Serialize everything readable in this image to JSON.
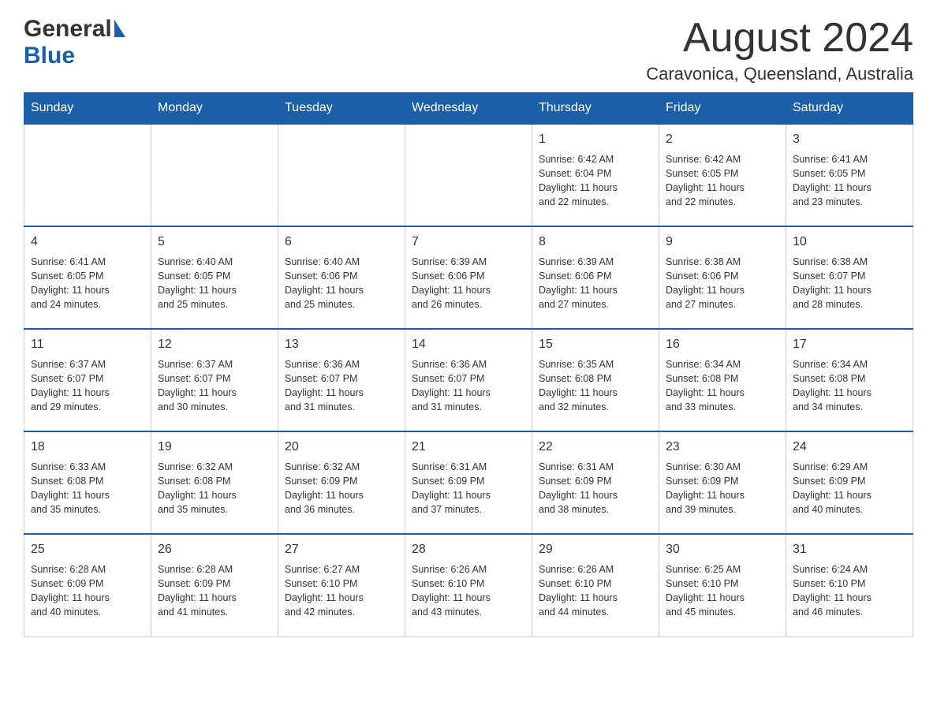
{
  "header": {
    "logo_general": "General",
    "logo_blue": "Blue",
    "month_title": "August 2024",
    "location": "Caravonica, Queensland, Australia"
  },
  "days_of_week": [
    "Sunday",
    "Monday",
    "Tuesday",
    "Wednesday",
    "Thursday",
    "Friday",
    "Saturday"
  ],
  "weeks": [
    {
      "days": [
        {
          "number": "",
          "info": ""
        },
        {
          "number": "",
          "info": ""
        },
        {
          "number": "",
          "info": ""
        },
        {
          "number": "",
          "info": ""
        },
        {
          "number": "1",
          "info": "Sunrise: 6:42 AM\nSunset: 6:04 PM\nDaylight: 11 hours\nand 22 minutes."
        },
        {
          "number": "2",
          "info": "Sunrise: 6:42 AM\nSunset: 6:05 PM\nDaylight: 11 hours\nand 22 minutes."
        },
        {
          "number": "3",
          "info": "Sunrise: 6:41 AM\nSunset: 6:05 PM\nDaylight: 11 hours\nand 23 minutes."
        }
      ]
    },
    {
      "days": [
        {
          "number": "4",
          "info": "Sunrise: 6:41 AM\nSunset: 6:05 PM\nDaylight: 11 hours\nand 24 minutes."
        },
        {
          "number": "5",
          "info": "Sunrise: 6:40 AM\nSunset: 6:05 PM\nDaylight: 11 hours\nand 25 minutes."
        },
        {
          "number": "6",
          "info": "Sunrise: 6:40 AM\nSunset: 6:06 PM\nDaylight: 11 hours\nand 25 minutes."
        },
        {
          "number": "7",
          "info": "Sunrise: 6:39 AM\nSunset: 6:06 PM\nDaylight: 11 hours\nand 26 minutes."
        },
        {
          "number": "8",
          "info": "Sunrise: 6:39 AM\nSunset: 6:06 PM\nDaylight: 11 hours\nand 27 minutes."
        },
        {
          "number": "9",
          "info": "Sunrise: 6:38 AM\nSunset: 6:06 PM\nDaylight: 11 hours\nand 27 minutes."
        },
        {
          "number": "10",
          "info": "Sunrise: 6:38 AM\nSunset: 6:07 PM\nDaylight: 11 hours\nand 28 minutes."
        }
      ]
    },
    {
      "days": [
        {
          "number": "11",
          "info": "Sunrise: 6:37 AM\nSunset: 6:07 PM\nDaylight: 11 hours\nand 29 minutes."
        },
        {
          "number": "12",
          "info": "Sunrise: 6:37 AM\nSunset: 6:07 PM\nDaylight: 11 hours\nand 30 minutes."
        },
        {
          "number": "13",
          "info": "Sunrise: 6:36 AM\nSunset: 6:07 PM\nDaylight: 11 hours\nand 31 minutes."
        },
        {
          "number": "14",
          "info": "Sunrise: 6:36 AM\nSunset: 6:07 PM\nDaylight: 11 hours\nand 31 minutes."
        },
        {
          "number": "15",
          "info": "Sunrise: 6:35 AM\nSunset: 6:08 PM\nDaylight: 11 hours\nand 32 minutes."
        },
        {
          "number": "16",
          "info": "Sunrise: 6:34 AM\nSunset: 6:08 PM\nDaylight: 11 hours\nand 33 minutes."
        },
        {
          "number": "17",
          "info": "Sunrise: 6:34 AM\nSunset: 6:08 PM\nDaylight: 11 hours\nand 34 minutes."
        }
      ]
    },
    {
      "days": [
        {
          "number": "18",
          "info": "Sunrise: 6:33 AM\nSunset: 6:08 PM\nDaylight: 11 hours\nand 35 minutes."
        },
        {
          "number": "19",
          "info": "Sunrise: 6:32 AM\nSunset: 6:08 PM\nDaylight: 11 hours\nand 35 minutes."
        },
        {
          "number": "20",
          "info": "Sunrise: 6:32 AM\nSunset: 6:09 PM\nDaylight: 11 hours\nand 36 minutes."
        },
        {
          "number": "21",
          "info": "Sunrise: 6:31 AM\nSunset: 6:09 PM\nDaylight: 11 hours\nand 37 minutes."
        },
        {
          "number": "22",
          "info": "Sunrise: 6:31 AM\nSunset: 6:09 PM\nDaylight: 11 hours\nand 38 minutes."
        },
        {
          "number": "23",
          "info": "Sunrise: 6:30 AM\nSunset: 6:09 PM\nDaylight: 11 hours\nand 39 minutes."
        },
        {
          "number": "24",
          "info": "Sunrise: 6:29 AM\nSunset: 6:09 PM\nDaylight: 11 hours\nand 40 minutes."
        }
      ]
    },
    {
      "days": [
        {
          "number": "25",
          "info": "Sunrise: 6:28 AM\nSunset: 6:09 PM\nDaylight: 11 hours\nand 40 minutes."
        },
        {
          "number": "26",
          "info": "Sunrise: 6:28 AM\nSunset: 6:09 PM\nDaylight: 11 hours\nand 41 minutes."
        },
        {
          "number": "27",
          "info": "Sunrise: 6:27 AM\nSunset: 6:10 PM\nDaylight: 11 hours\nand 42 minutes."
        },
        {
          "number": "28",
          "info": "Sunrise: 6:26 AM\nSunset: 6:10 PM\nDaylight: 11 hours\nand 43 minutes."
        },
        {
          "number": "29",
          "info": "Sunrise: 6:26 AM\nSunset: 6:10 PM\nDaylight: 11 hours\nand 44 minutes."
        },
        {
          "number": "30",
          "info": "Sunrise: 6:25 AM\nSunset: 6:10 PM\nDaylight: 11 hours\nand 45 minutes."
        },
        {
          "number": "31",
          "info": "Sunrise: 6:24 AM\nSunset: 6:10 PM\nDaylight: 11 hours\nand 46 minutes."
        }
      ]
    }
  ]
}
